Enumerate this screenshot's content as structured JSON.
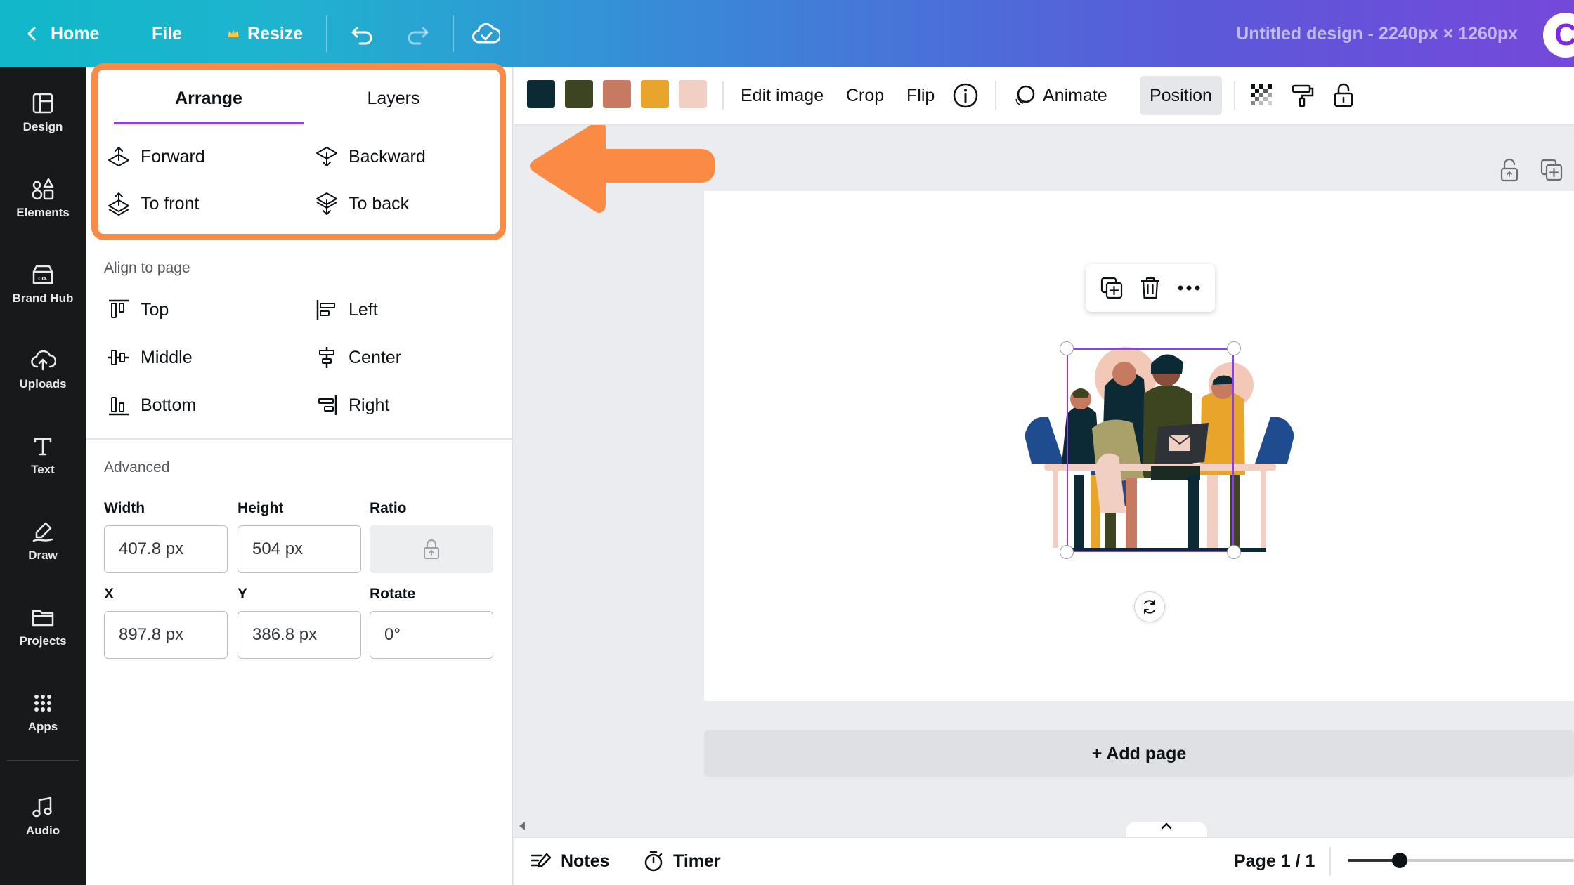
{
  "topbar": {
    "home_label": "Home",
    "file_label": "File",
    "resize_label": "Resize",
    "doc_title": "Untitled design - 2240px × 1260px",
    "avatar_letter": "C"
  },
  "rail": {
    "items": [
      {
        "label": "Design",
        "icon": "design-icon"
      },
      {
        "label": "Elements",
        "icon": "elements-icon"
      },
      {
        "label": "Brand Hub",
        "icon": "brand-hub-icon"
      },
      {
        "label": "Uploads",
        "icon": "uploads-icon"
      },
      {
        "label": "Text",
        "icon": "text-icon"
      },
      {
        "label": "Draw",
        "icon": "draw-icon"
      },
      {
        "label": "Projects",
        "icon": "projects-icon"
      },
      {
        "label": "Apps",
        "icon": "apps-icon"
      },
      {
        "label": "Audio",
        "icon": "audio-icon"
      }
    ]
  },
  "panel": {
    "tabs": [
      "Arrange",
      "Layers"
    ],
    "active_tab": "Arrange",
    "arrange": {
      "forward": "Forward",
      "backward": "Backward",
      "to_front": "To front",
      "to_back": "To back"
    },
    "align_title": "Align to page",
    "align": {
      "top": "Top",
      "left": "Left",
      "middle": "Middle",
      "center": "Center",
      "bottom": "Bottom",
      "right": "Right"
    },
    "advanced_title": "Advanced",
    "fields": {
      "width_label": "Width",
      "height_label": "Height",
      "ratio_label": "Ratio",
      "x_label": "X",
      "y_label": "Y",
      "rotate_label": "Rotate",
      "width_value": "407.8 px",
      "height_value": "504 px",
      "x_value": "897.8 px",
      "y_value": "386.8 px",
      "rotate_value": "0°"
    }
  },
  "context_toolbar": {
    "swatches": [
      "#0b2a33",
      "#3d4420",
      "#c77a62",
      "#e9a52b",
      "#f1cfc2"
    ],
    "edit_image": "Edit image",
    "crop": "Crop",
    "flip": "Flip",
    "animate": "Animate",
    "position": "Position"
  },
  "canvas": {
    "add_page": "+ Add page"
  },
  "bottombar": {
    "notes": "Notes",
    "timer": "Timer",
    "page_indicator": "Page 1 / 1",
    "zoom_level": 0.23
  },
  "colors": {
    "accent": "#8b3dff",
    "highlight": "#fb8a44"
  }
}
